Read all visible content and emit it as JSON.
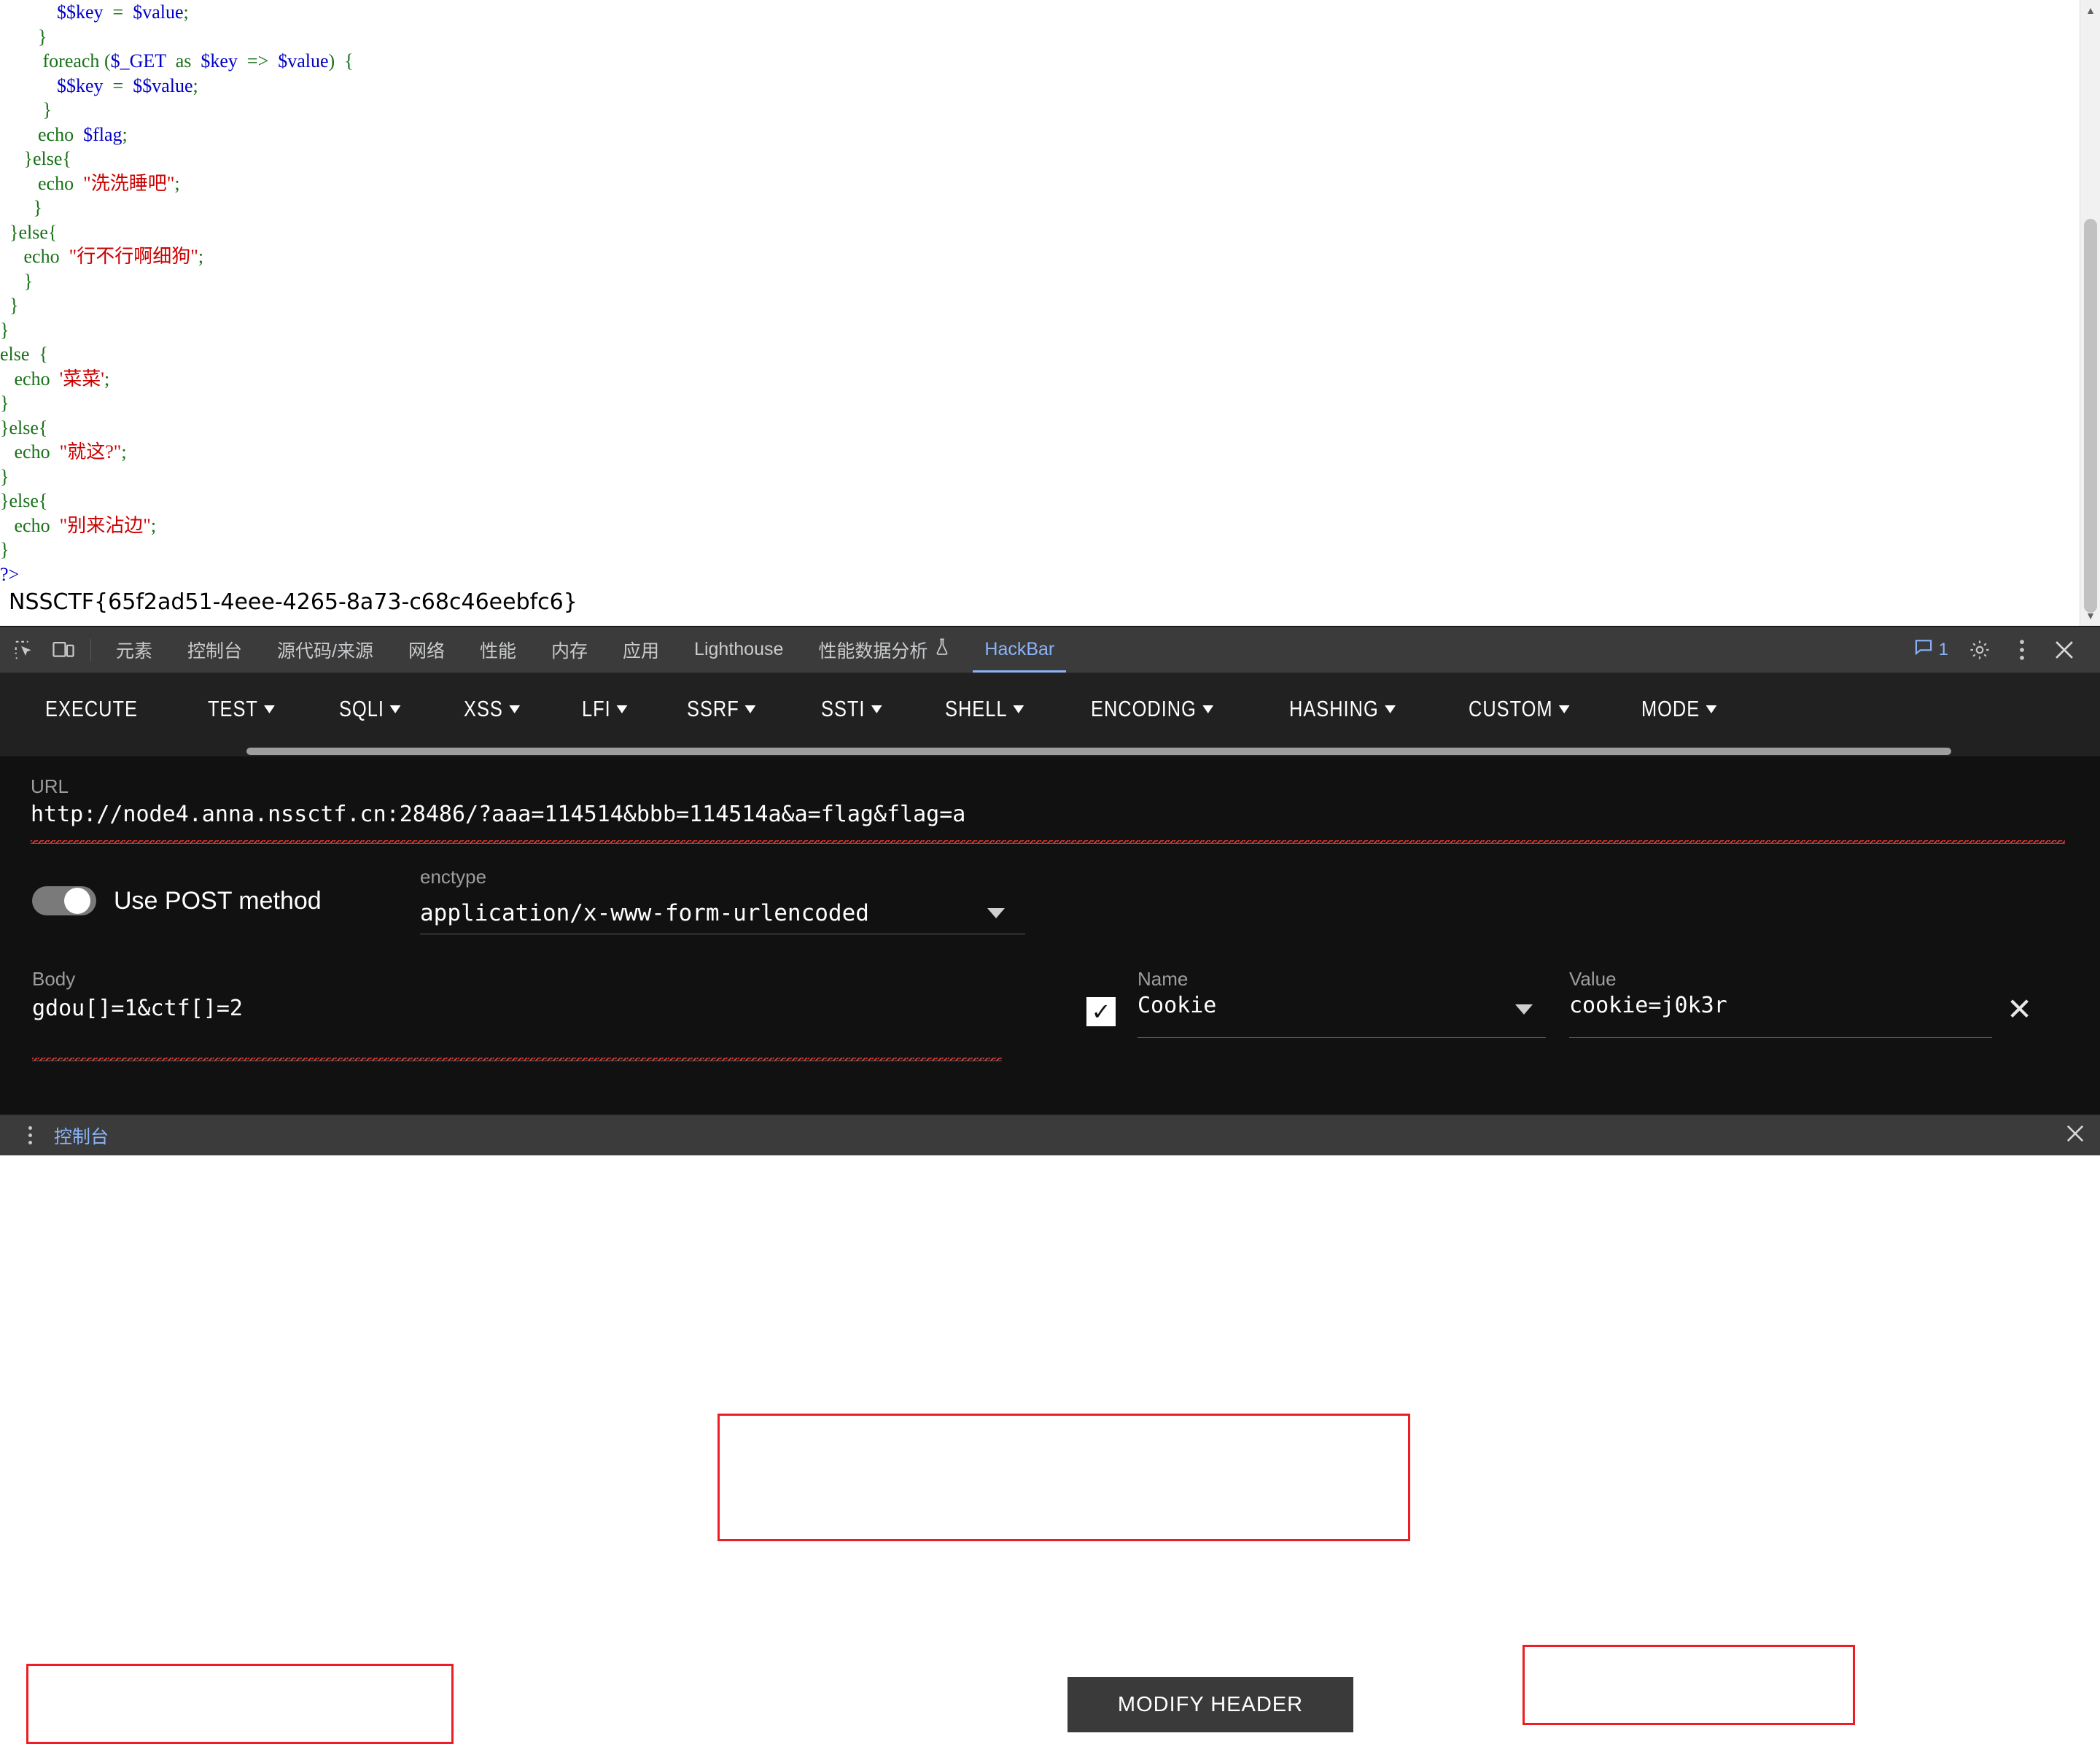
{
  "page": {
    "code_lines": [
      [
        {
          "t": "            ",
          "c": "kw"
        },
        {
          "t": "$$key",
          "c": "var"
        },
        {
          "t": "  =  ",
          "c": "kw"
        },
        {
          "t": "$value",
          "c": "var"
        },
        {
          "t": ";",
          "c": "kw"
        }
      ],
      [
        {
          "t": "        }",
          "c": "kw"
        }
      ],
      [
        {
          "t": "         foreach ",
          "c": "kw"
        },
        {
          "t": "(",
          "c": "kw"
        },
        {
          "t": "$_GET",
          "c": "var"
        },
        {
          "t": "  as  ",
          "c": "kw"
        },
        {
          "t": "$key",
          "c": "var"
        },
        {
          "t": "  =>  ",
          "c": "kw"
        },
        {
          "t": "$value",
          "c": "var"
        },
        {
          "t": ")",
          "c": "kw"
        },
        {
          "t": "  {",
          "c": "kw"
        }
      ],
      [
        {
          "t": "            ",
          "c": "kw"
        },
        {
          "t": "$$key",
          "c": "var"
        },
        {
          "t": "  =  ",
          "c": "kw"
        },
        {
          "t": "$$value",
          "c": "var"
        },
        {
          "t": ";",
          "c": "kw"
        }
      ],
      [
        {
          "t": "         }",
          "c": "kw"
        }
      ],
      [
        {
          "t": "        echo  ",
          "c": "kw"
        },
        {
          "t": "$flag",
          "c": "var"
        },
        {
          "t": ";",
          "c": "kw"
        }
      ],
      [
        {
          "t": "     }else{",
          "c": "kw"
        }
      ],
      [
        {
          "t": "        echo  ",
          "c": "kw"
        },
        {
          "t": "\"洗洗睡吧\"",
          "c": "str"
        },
        {
          "t": ";",
          "c": "kw"
        }
      ],
      [
        {
          "t": "       }",
          "c": "kw"
        }
      ],
      [
        {
          "t": "  }else{",
          "c": "kw"
        }
      ],
      [
        {
          "t": "     echo  ",
          "c": "kw"
        },
        {
          "t": "\"行不行啊细狗\"",
          "c": "str"
        },
        {
          "t": ";",
          "c": "kw"
        }
      ],
      [
        {
          "t": "     }",
          "c": "kw"
        }
      ],
      [
        {
          "t": "  }",
          "c": "kw"
        }
      ],
      [
        {
          "t": "}",
          "c": "kw"
        }
      ],
      [
        {
          "t": "else  {",
          "c": "kw"
        }
      ],
      [
        {
          "t": "   echo  ",
          "c": "kw"
        },
        {
          "t": "'菜菜'",
          "c": "str"
        },
        {
          "t": ";",
          "c": "kw"
        }
      ],
      [
        {
          "t": "}",
          "c": "kw"
        }
      ],
      [
        {
          "t": "}else{",
          "c": "kw"
        }
      ],
      [
        {
          "t": "   echo  ",
          "c": "kw"
        },
        {
          "t": "\"就这?\"",
          "c": "str"
        },
        {
          "t": ";",
          "c": "kw"
        }
      ],
      [
        {
          "t": "}",
          "c": "kw"
        }
      ],
      [
        {
          "t": "}else{",
          "c": "kw"
        }
      ],
      [
        {
          "t": "   echo  ",
          "c": "kw"
        },
        {
          "t": "\"别来沾边\"",
          "c": "str"
        },
        {
          "t": ";",
          "c": "kw"
        }
      ],
      [
        {
          "t": "}",
          "c": "kw"
        }
      ],
      [
        {
          "t": "?>",
          "c": "pct"
        }
      ]
    ],
    "flag": "NSSCTF{65f2ad51-4eee-4265-8a73-c68c46eebfc6}"
  },
  "devtools": {
    "inspect_icon": "inspect-element-icon",
    "device_icon": "device-toolbar-icon",
    "tabs": [
      {
        "label": "元素",
        "active": false
      },
      {
        "label": "控制台",
        "active": false
      },
      {
        "label": "源代码/来源",
        "active": false
      },
      {
        "label": "网络",
        "active": false
      },
      {
        "label": "性能",
        "active": false
      },
      {
        "label": "内存",
        "active": false
      },
      {
        "label": "应用",
        "active": false
      },
      {
        "label": "Lighthouse",
        "active": false
      },
      {
        "label": "性能数据分析",
        "active": false,
        "trailing_icon": "flask-icon"
      },
      {
        "label": "HackBar",
        "active": true
      }
    ],
    "message_count": "1",
    "message_icon": "message-bubble-icon",
    "settings_icon": "gear-icon",
    "more_icon": "more-vertical-icon",
    "close_icon": "close-icon"
  },
  "hackbar": {
    "menu": [
      {
        "label": "EXECUTE",
        "has_caret": false
      },
      {
        "label": "TEST",
        "has_caret": true
      },
      {
        "label": "SQLI",
        "has_caret": true
      },
      {
        "label": "XSS",
        "has_caret": true
      },
      {
        "label": "LFI",
        "has_caret": true
      },
      {
        "label": "SSRF",
        "has_caret": true
      },
      {
        "label": "SSTI",
        "has_caret": true
      },
      {
        "label": "SHELL",
        "has_caret": true
      },
      {
        "label": "ENCODING",
        "has_caret": true
      },
      {
        "label": "HASHING",
        "has_caret": true
      },
      {
        "label": "CUSTOM",
        "has_caret": true
      },
      {
        "label": "MODE",
        "has_caret": true
      }
    ],
    "url_label": "URL",
    "url_value": "http://node4.anna.nssctf.cn:28486/?aaa=114514&bbb=114514a&a=flag&flag=a",
    "post_toggle_label": "Use POST method",
    "post_toggle_on": true,
    "enctype_label": "enctype",
    "enctype_value": "application/x-www-form-urlencoded",
    "modify_header_label": "MODIFY HEADER",
    "body_label": "Body",
    "body_value": "gdou[]=1&ctf[]=2",
    "header_name_label": "Name",
    "header_name_value": "Cookie",
    "header_name_checked": true,
    "header_value_label": "Value",
    "header_value_value": "cookie=j0k3r",
    "remove_header_icon": "close-icon"
  },
  "drawer": {
    "menu_icon": "more-vertical-icon",
    "tab_label": "控制台",
    "close_icon": "close-icon"
  },
  "colors": {
    "accent_blue": "#8ab4f8",
    "annotation_red": "#ee1c24",
    "devtools_bg": "#202124",
    "panel_bg": "#111111",
    "tabstrip_bg": "#3b3b3b"
  }
}
